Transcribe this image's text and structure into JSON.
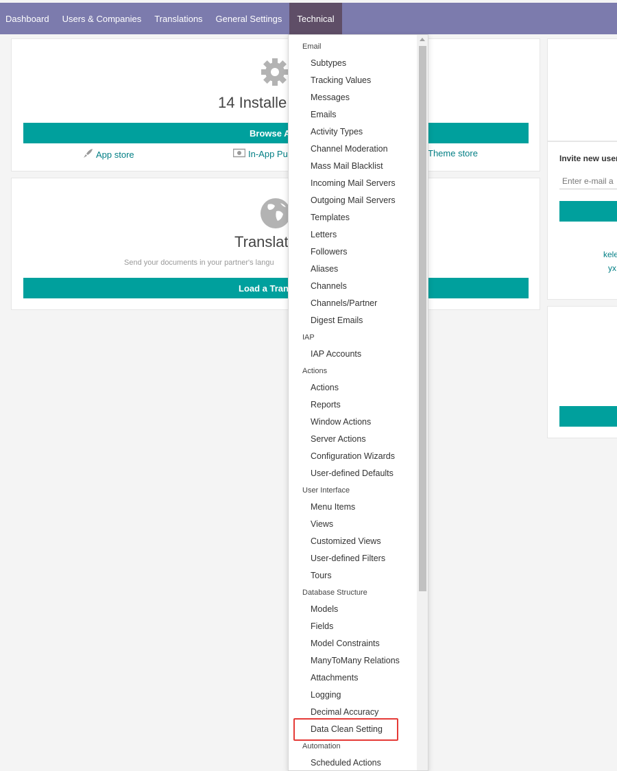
{
  "nav": {
    "items": [
      "Dashboard",
      "Users & Companies",
      "Translations",
      "General Settings",
      "Technical"
    ],
    "active": "Technical"
  },
  "apps_card": {
    "title": "14 Installe",
    "button": "Browse A",
    "links": [
      "App store",
      "In-App Pu",
      "Theme store"
    ]
  },
  "translations_card": {
    "title": "Translat",
    "subtitle": "Send your documents in your partner's langu",
    "button": "Load a Trans"
  },
  "invite": {
    "title": "Invite new user",
    "placeholder": "Enter e-mail a",
    "links": [
      "kele",
      "yx"
    ]
  },
  "menu": {
    "sections": [
      {
        "header": "Email",
        "items": [
          "Subtypes",
          "Tracking Values",
          "Messages",
          "Emails",
          "Activity Types",
          "Channel Moderation",
          "Mass Mail Blacklist",
          "Incoming Mail Servers",
          "Outgoing Mail Servers",
          "Templates",
          "Letters",
          "Followers",
          "Aliases",
          "Channels",
          "Channels/Partner",
          "Digest Emails"
        ]
      },
      {
        "header": "IAP",
        "items": [
          "IAP Accounts"
        ]
      },
      {
        "header": "Actions",
        "items": [
          "Actions",
          "Reports",
          "Window Actions",
          "Server Actions",
          "Configuration Wizards",
          "User-defined Defaults"
        ]
      },
      {
        "header": "User Interface",
        "items": [
          "Menu Items",
          "Views",
          "Customized Views",
          "User-defined Filters",
          "Tours"
        ]
      },
      {
        "header": "Database Structure",
        "items": [
          "Models",
          "Fields",
          "Model Constraints",
          "ManyToMany Relations",
          "Attachments",
          "Logging",
          "Decimal Accuracy",
          "Data Clean Setting"
        ]
      },
      {
        "header": "Automation",
        "items": [
          "Scheduled Actions"
        ]
      }
    ],
    "highlighted_item": "Data Clean Setting"
  },
  "colors": {
    "navbar": "#7c7bad",
    "nav_active": "#5f4e67",
    "teal": "#00a09d",
    "link": "#017e84",
    "highlight": "#e53935"
  }
}
